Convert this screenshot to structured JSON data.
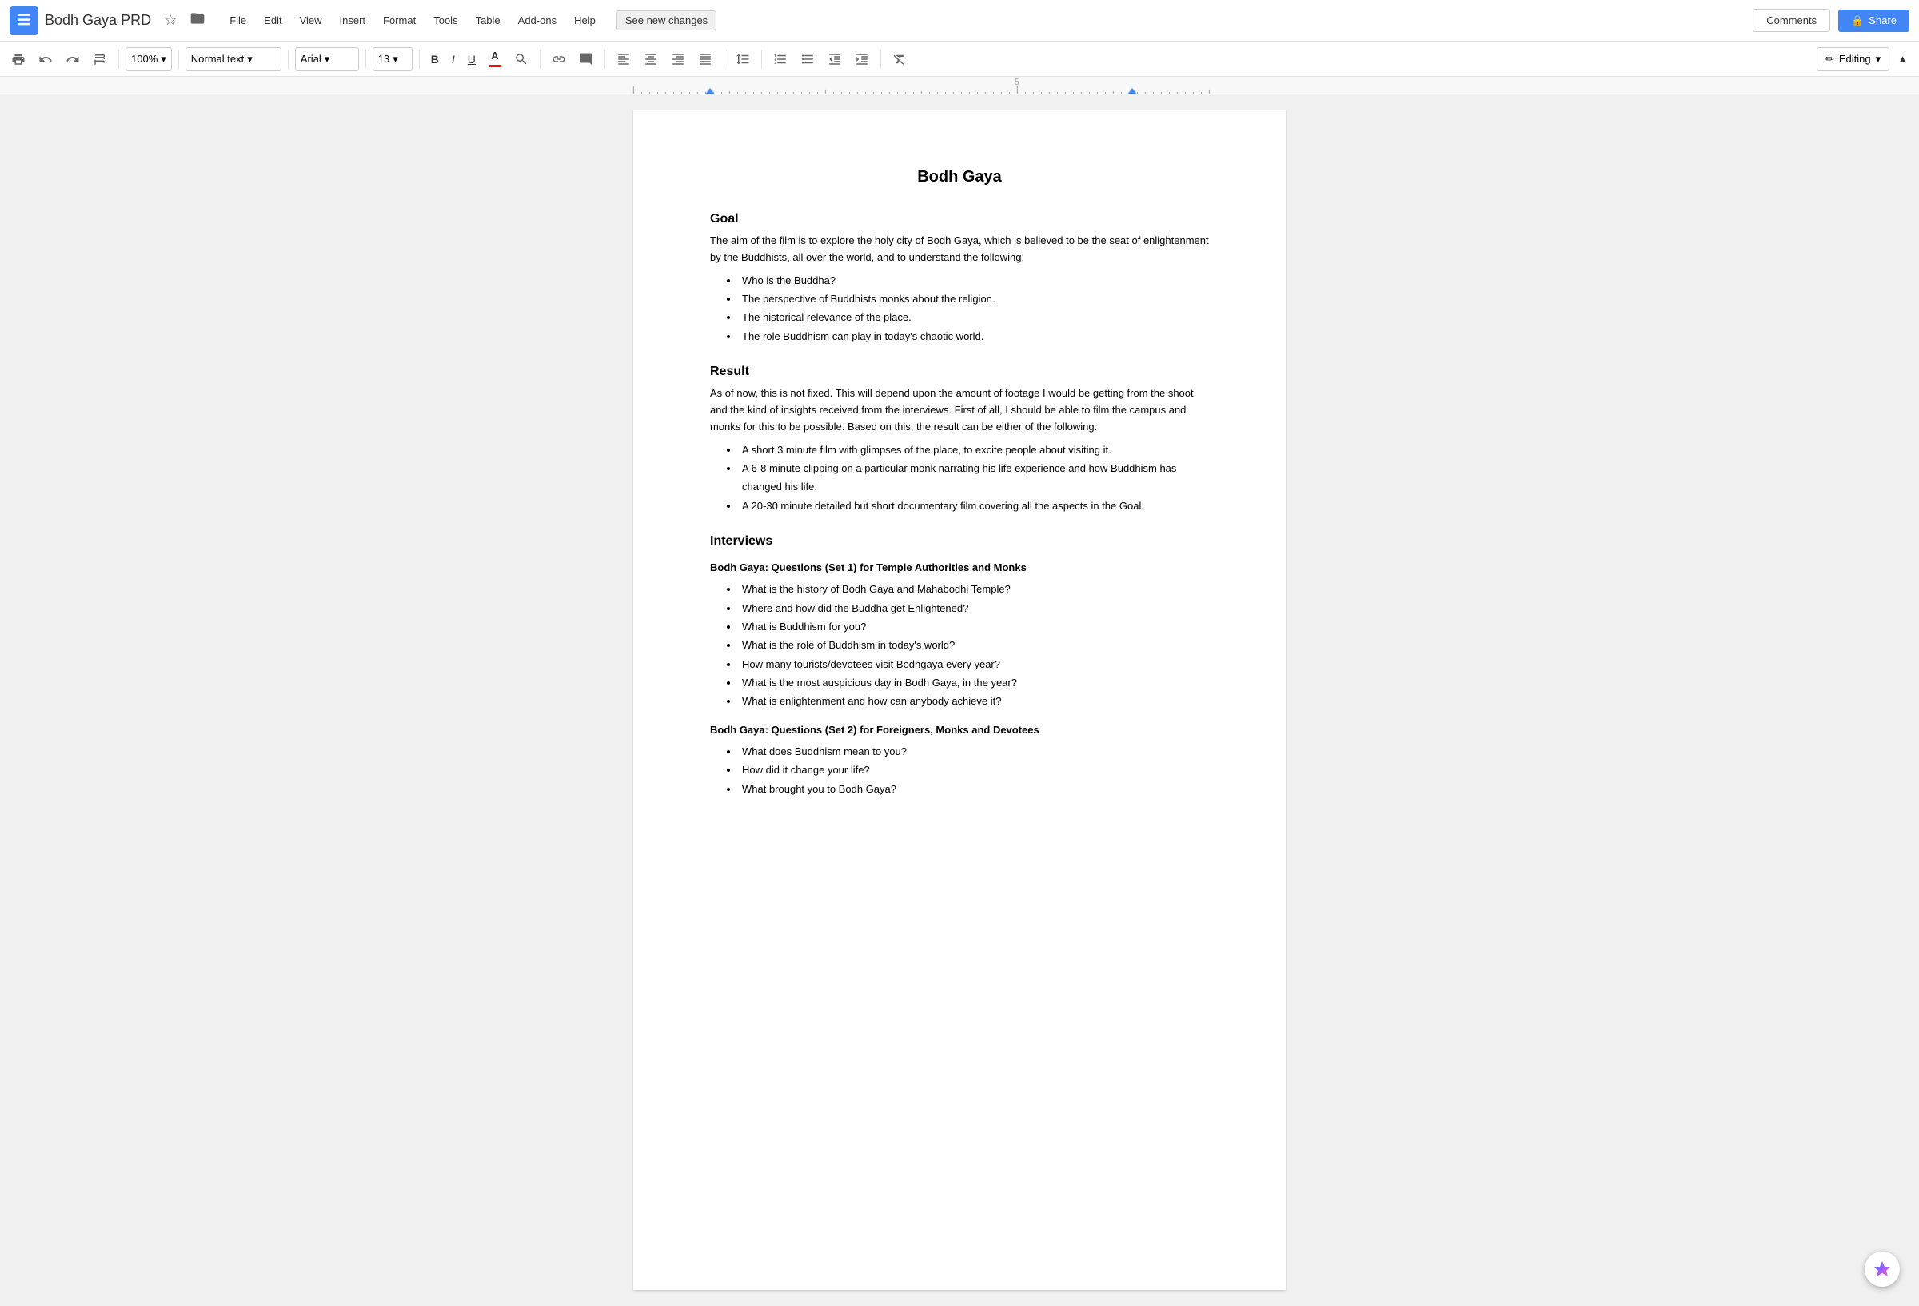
{
  "app": {
    "icon_letter": "≡",
    "doc_title": "Bodh Gaya PRD",
    "star_icon": "☆",
    "folder_icon": "📁"
  },
  "menu": {
    "items": [
      "File",
      "Edit",
      "View",
      "Insert",
      "Format",
      "Tools",
      "Table",
      "Add-ons",
      "Help"
    ]
  },
  "see_new_changes": "See new changes",
  "right_controls": {
    "comments": "Comments",
    "share": "Share",
    "lock_icon": "🔒"
  },
  "toolbar": {
    "print": "🖨",
    "undo": "↩",
    "redo": "↪",
    "paint": "🖌",
    "zoom": "100%",
    "text_style": "Normal text",
    "font": "Arial",
    "font_size": "13",
    "bold": "B",
    "italic": "I",
    "underline": "U",
    "text_color": "A",
    "highlight_color": "⬡",
    "link": "🔗",
    "comment": "💬",
    "align_left": "≡",
    "align_center": "≡",
    "align_right": "≡",
    "align_justify": "≡",
    "line_spacing": "↕",
    "numbered_list": "1.",
    "bullet_list": "•",
    "indent_less": "←",
    "indent_more": "→",
    "clear_format": "Tx",
    "editing_mode": "Editing",
    "pencil_icon": "✏",
    "chevron_down": "▾",
    "collapse": "▲"
  },
  "document": {
    "title": "Bodh Gaya",
    "sections": [
      {
        "id": "goal",
        "heading": "Goal",
        "type": "section",
        "body": "The aim of the film is to explore the holy city of Bodh Gaya, which is believed to be the seat of enlightenment by the Buddhists, all over the world, and to understand the following:",
        "bullets": [
          "Who is the Buddha?",
          "The perspective of Buddhists monks about the religion.",
          "The historical relevance of the place.",
          "The role Buddhism can play in today's chaotic world."
        ]
      },
      {
        "id": "result",
        "heading": "Result",
        "type": "section",
        "body": "As of now, this is not fixed. This will depend upon the amount of footage I would be getting from the shoot and the kind of insights received from the interviews. First of all, I should be able to film the campus and monks for this to be possible. Based on this, the result can be either of the following:",
        "bullets": [
          "A short 3 minute film with glimpses of the place, to excite people about visiting it.",
          "A 6-8 minute clipping on a particular monk narrating his life experience and how Buddhism has changed his life.",
          "A 20-30 minute detailed but short documentary film covering all the aspects in the Goal."
        ]
      },
      {
        "id": "interviews",
        "heading": "Interviews",
        "type": "section",
        "body": "",
        "bullets": [],
        "subsections": [
          {
            "id": "set1",
            "subheading": "Bodh Gaya: Questions (Set 1) for Temple Authorities and Monks",
            "bullets": [
              "What is the history of Bodh Gaya and Mahabodhi Temple?",
              "Where and how did the Buddha get Enlightened?",
              "What is Buddhism for you?",
              "What is the role of Buddhism in today's world?",
              "How many tourists/devotees visit Bodhgaya every year?",
              "What is the most auspicious day in Bodh Gaya, in the year?",
              "What is enlightenment and how can anybody achieve it?"
            ]
          },
          {
            "id": "set2",
            "subheading": "Bodh Gaya: Questions (Set 2) for Foreigners, Monks and Devotees",
            "bullets": [
              "What does Buddhism mean to you?",
              "How did it change your life?",
              "What brought you to Bodh Gaya?"
            ]
          }
        ]
      }
    ]
  },
  "colors": {
    "brand_blue": "#4285f4",
    "text_color_red": "#ff0000",
    "toolbar_bg": "#ffffff",
    "page_bg": "#f0f0f0",
    "page_white": "#ffffff"
  }
}
